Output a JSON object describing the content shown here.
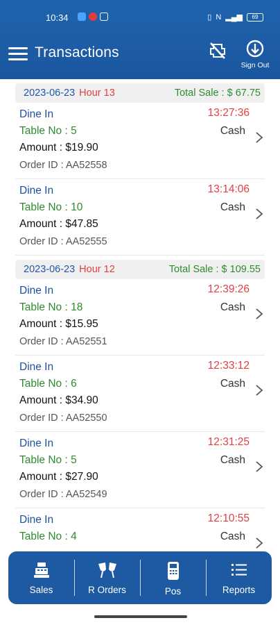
{
  "status": {
    "time": "10:34",
    "battery": "69"
  },
  "header": {
    "title": "Transactions",
    "sign_out_label": "Sign Out"
  },
  "groups": [
    {
      "date": "2023-06-23",
      "hour": "Hour 13",
      "total": "Total Sale : $ 67.75",
      "transactions": [
        {
          "type": "Dine In",
          "table": "Table No : 5",
          "amount": "Amount : $19.90",
          "order_id": "Order ID : AA52558",
          "time": "13:27:36",
          "payment": "Cash"
        },
        {
          "type": "Dine In",
          "table": "Table No : 10",
          "amount": "Amount : $47.85",
          "order_id": "Order ID : AA52555",
          "time": "13:14:06",
          "payment": "Cash"
        }
      ]
    },
    {
      "date": "2023-06-23",
      "hour": "Hour 12",
      "total": "Total Sale : $ 109.55",
      "transactions": [
        {
          "type": "Dine In",
          "table": "Table No : 18",
          "amount": "Amount : $15.95",
          "order_id": "Order ID : AA52551",
          "time": "12:39:26",
          "payment": "Cash"
        },
        {
          "type": "Dine In",
          "table": "Table No : 6",
          "amount": "Amount : $34.90",
          "order_id": "Order ID : AA52550",
          "time": "12:33:12",
          "payment": "Cash"
        },
        {
          "type": "Dine In",
          "table": "Table No : 5",
          "amount": "Amount : $27.90",
          "order_id": "Order ID : AA52549",
          "time": "12:31:25",
          "payment": "Cash"
        },
        {
          "type": "Dine In",
          "table": "Table No : 4",
          "amount": "",
          "order_id": "",
          "time": "12:10:55",
          "payment": "Cash"
        }
      ]
    }
  ],
  "bottom_nav": [
    {
      "label": "Sales",
      "icon": "cash-register-icon"
    },
    {
      "label": "R Orders",
      "icon": "cheers-icon"
    },
    {
      "label": "Pos",
      "icon": "pos-terminal-icon"
    },
    {
      "label": "Reports",
      "icon": "list-icon"
    }
  ],
  "colors": {
    "primary": "#1e5aa2",
    "red": "#e04040",
    "green": "#2e8b2e",
    "blue_text": "#1f4f9c"
  }
}
